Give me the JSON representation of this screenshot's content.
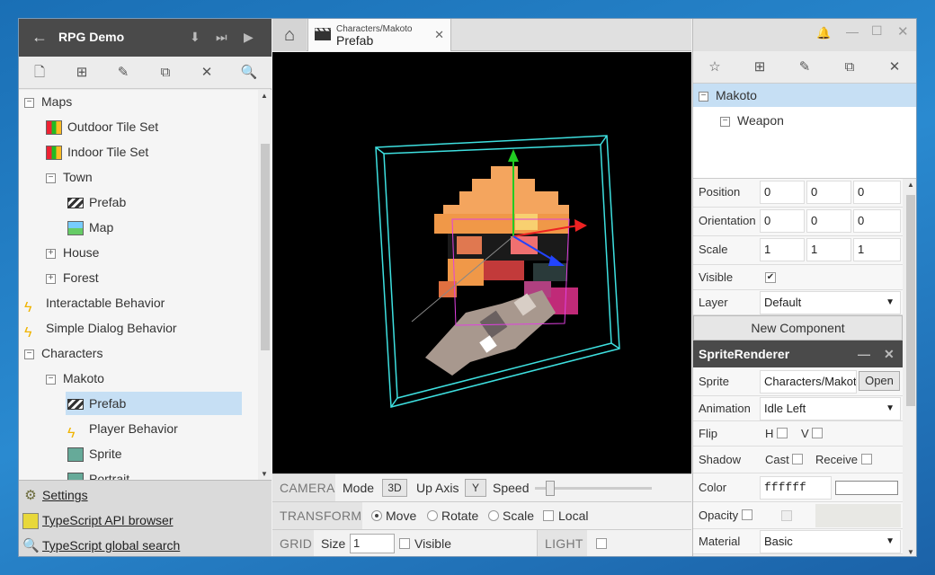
{
  "project": {
    "title": "RPG Demo"
  },
  "tree": [
    {
      "label": "Maps",
      "kind": "folder",
      "depth": 0
    },
    {
      "label": "Outdoor Tile Set",
      "kind": "tileset",
      "depth": 1
    },
    {
      "label": "Indoor Tile Set",
      "kind": "tileset",
      "depth": 1
    },
    {
      "label": "Town",
      "kind": "folder",
      "depth": 1
    },
    {
      "label": "Prefab",
      "kind": "prefab",
      "depth": 2
    },
    {
      "label": "Map",
      "kind": "map",
      "depth": 2
    },
    {
      "label": "House",
      "kind": "folder-collapsed",
      "depth": 1
    },
    {
      "label": "Forest",
      "kind": "folder-collapsed",
      "depth": 1
    },
    {
      "label": "Interactable Behavior",
      "kind": "script",
      "depth": 0
    },
    {
      "label": "Simple Dialog Behavior",
      "kind": "script",
      "depth": 0
    },
    {
      "label": "Characters",
      "kind": "folder",
      "depth": 0
    },
    {
      "label": "Makoto",
      "kind": "folder",
      "depth": 1
    },
    {
      "label": "Prefab",
      "kind": "prefab",
      "depth": 2,
      "selected": true
    },
    {
      "label": "Player Behavior",
      "kind": "script",
      "depth": 2
    },
    {
      "label": "Sprite",
      "kind": "sprite",
      "depth": 2
    },
    {
      "label": "Portrait",
      "kind": "sprite",
      "depth": 2
    }
  ],
  "links": {
    "settings": "Settings",
    "api": "TypeScript API browser",
    "search": "TypeScript global search"
  },
  "tab": {
    "sub": "Characters/Makoto",
    "main": "Prefab"
  },
  "camera": {
    "label": "CAMERA",
    "mode_label": "Mode",
    "mode_value": "3D",
    "up_label": "Up Axis",
    "up_value": "Y",
    "speed_label": "Speed",
    "speed": 0.1
  },
  "transform": {
    "label": "TRANSFORM",
    "move": "Move",
    "rotate": "Rotate",
    "scale": "Scale",
    "local": "Local"
  },
  "grid": {
    "label": "GRID",
    "size_label": "Size",
    "size_value": "1",
    "visible": "Visible",
    "light": "LIGHT"
  },
  "scene": {
    "root": "Makoto",
    "child": "Weapon"
  },
  "inspector": {
    "position": {
      "label": "Position",
      "x": "0",
      "y": "0",
      "z": "0"
    },
    "orientation": {
      "label": "Orientation",
      "x": "0",
      "y": "0",
      "z": "0"
    },
    "scale": {
      "label": "Scale",
      "x": "1",
      "y": "1",
      "z": "1"
    },
    "visible": {
      "label": "Visible"
    },
    "layer": {
      "label": "Layer",
      "value": "Default"
    },
    "new_component": "New Component",
    "sprite_renderer": {
      "title": "SpriteRenderer",
      "sprite_label": "Sprite",
      "sprite_value": "Characters/Makoto",
      "open": "Open",
      "animation_label": "Animation",
      "animation_value": "Idle Left",
      "flip_label": "Flip",
      "flip_h": "H",
      "flip_v": "V",
      "shadow_label": "Shadow",
      "cast": "Cast",
      "receive": "Receive",
      "color_label": "Color",
      "color_value": "ffffff",
      "opacity_label": "Opacity",
      "material_label": "Material",
      "material_value": "Basic"
    }
  },
  "colors": {
    "selection": "#c6dff4",
    "header": "#4a4a4a",
    "gizmo_box": "#3ee0e0",
    "desktop": "#1a6fb5"
  }
}
